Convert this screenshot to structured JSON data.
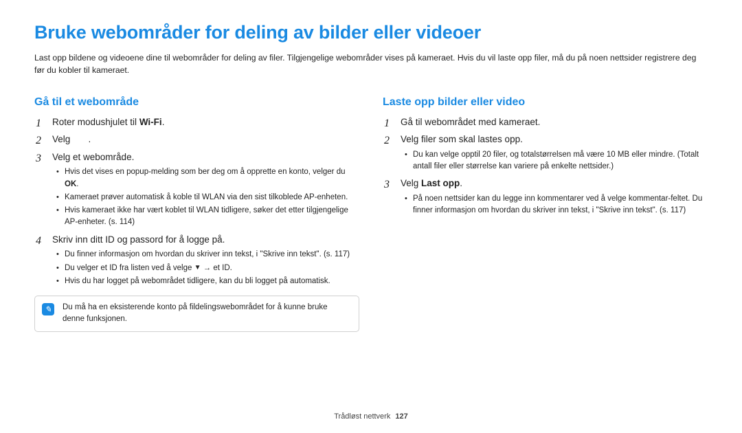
{
  "title": "Bruke webområder for deling av bilder eller videoer",
  "intro": "Last opp bildene og videoene dine til webområder for deling av filer. Tilgjengelige webområder vises på kameraet. Hvis du vil laste opp filer, må du på noen nettsider registrere deg før du kobler til kameraet.",
  "left": {
    "heading": "Gå til et webområde",
    "step1_prefix": "Roter modushjulet til ",
    "step1_wifi": "Wi-Fi",
    "step1_suffix": ".",
    "step2_prefix": "Velg ",
    "step2_suffix": ".",
    "step3": "Velg et webområde.",
    "step3_sub1_a": "Hvis det vises en popup-melding som ber deg om å opprette en konto, velger du ",
    "step3_sub1_bold": "OK",
    "step3_sub1_b": ".",
    "step3_sub2": "Kameraet prøver automatisk å koble til WLAN via den sist tilkoblede AP-enheten.",
    "step3_sub3": "Hvis kameraet ikke har vært koblet til WLAN tidligere, søker det etter tilgjengelige AP-enheter. (s. 114)",
    "step4": "Skriv inn ditt ID og passord for å logge på.",
    "step4_sub1": "Du finner informasjon om hvordan du skriver inn tekst, i \"Skrive inn tekst\". (s. 117)",
    "step4_sub2_a": "Du velger et ID fra listen ved å velge ",
    "step4_sub2_b": " → et ID.",
    "step4_sub3": "Hvis du har logget på webområdet tidligere, kan du bli logget på automatisk.",
    "infobox": "Du må ha en eksisterende konto på fildelingswebområdet for å kunne bruke denne funksjonen."
  },
  "right": {
    "heading": "Laste opp bilder eller video",
    "step1": "Gå til webområdet med kameraet.",
    "step2": "Velg filer som skal lastes opp.",
    "step2_sub1": "Du kan velge opptil 20 filer, og totalstørrelsen må være 10 MB eller mindre. (Totalt antall filer eller størrelse kan variere på enkelte nettsider.)",
    "step3_a": "Velg ",
    "step3_bold": "Last opp",
    "step3_b": ".",
    "step3_sub1": "På noen nettsider kan du legge inn kommentarer ved å velge kommentar-feltet. Du finner informasjon om hvordan du skriver inn tekst, i \"Skrive inn tekst\". (s. 117)"
  },
  "footer": {
    "section": "Trådløst nettverk",
    "page": "127"
  }
}
